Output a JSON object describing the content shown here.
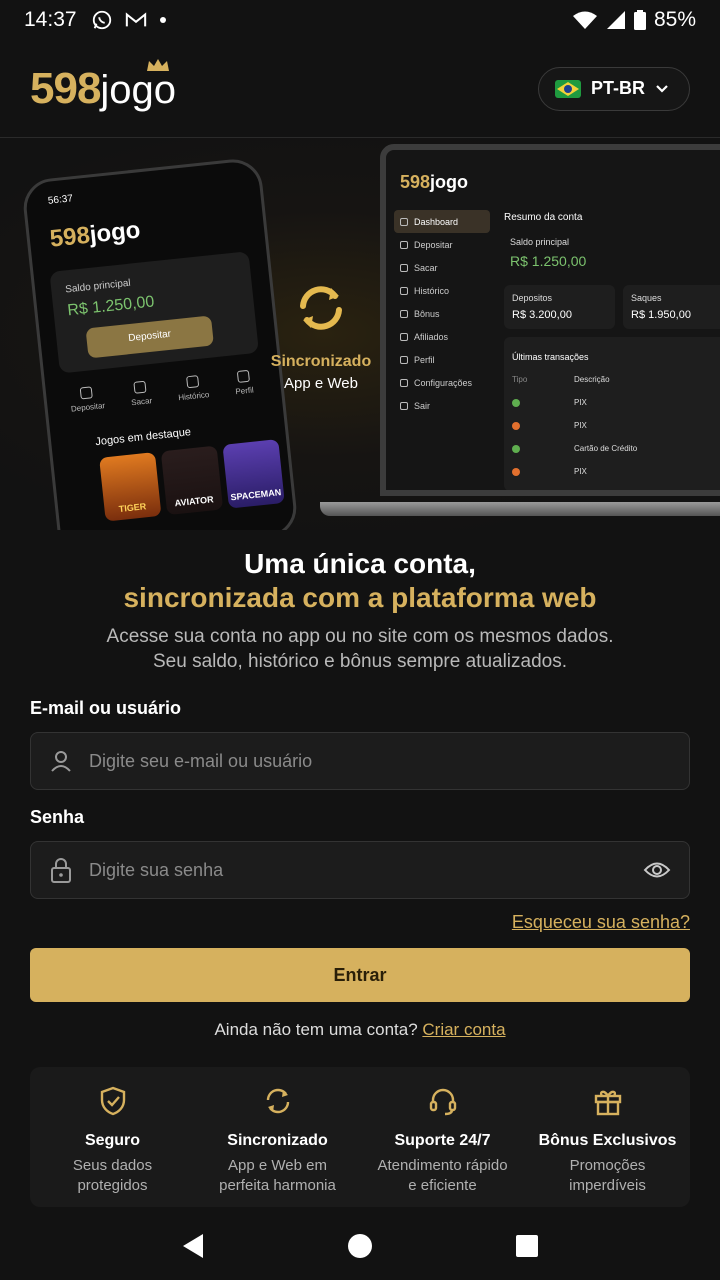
{
  "status_bar": {
    "time": "14:37",
    "battery": "85%"
  },
  "header": {
    "logo_number": "598",
    "logo_word": "jogo",
    "language": "PT-BR"
  },
  "hero": {
    "phone": {
      "time": "56:37",
      "logo_number": "598",
      "logo_word": "jogo",
      "balance_label": "Saldo principal",
      "balance_value": "R$ 1.250,00",
      "deposit_button": "Depositar",
      "nav": [
        "Depositar",
        "Sacar",
        "Histórico",
        "Perfil"
      ],
      "featured_label": "Jogos em destaque",
      "games": [
        "TIGER",
        "AVIATOR",
        "SPACEMAN"
      ]
    },
    "sync": {
      "title": "Sincronizado",
      "subtitle": "App e Web"
    },
    "laptop": {
      "logo_number": "598",
      "logo_word": "jogo",
      "menu": [
        "Dashboard",
        "Depositar",
        "Sacar",
        "Histórico",
        "Bônus",
        "Afiliados",
        "Perfil",
        "Configurações",
        "Sair"
      ],
      "summary_title": "Resumo da conta",
      "balance_label": "Saldo principal",
      "balance_value": "R$ 1.250,00",
      "deposits_label": "Depositos",
      "deposits_value": "R$ 3.200,00",
      "withdrawals_label": "Saques",
      "withdrawals_value": "R$ 1.950,00",
      "transactions_title": "Últimas transações",
      "col_type": "Tipo",
      "col_desc": "Descrição",
      "rows": [
        {
          "desc": "PIX",
          "color": "#5fae4f"
        },
        {
          "desc": "PIX",
          "color": "#e2702e"
        },
        {
          "desc": "Cartão de Crédito",
          "color": "#5fae4f"
        },
        {
          "desc": "PIX",
          "color": "#e2702e"
        }
      ]
    }
  },
  "headline": {
    "line1": "Uma única conta,",
    "line2": "sincronizada com a plataforma web",
    "sub1": "Acesse sua conta no app ou no site com os mesmos dados.",
    "sub2": "Seu saldo, histórico e bônus sempre atualizados."
  },
  "form": {
    "email_label": "E-mail ou usuário",
    "email_placeholder": "Digite seu e-mail ou usuário",
    "password_label": "Senha",
    "password_placeholder": "Digite sua senha",
    "forgot": "Esqueceu sua senha?",
    "submit": "Entrar",
    "signup_text": "Ainda não tem uma conta?",
    "signup_link": "Criar conta"
  },
  "features": [
    {
      "icon": "shield-check-icon",
      "title": "Seguro",
      "line1": "Seus dados",
      "line2": "protegidos"
    },
    {
      "icon": "sync-icon",
      "title": "Sincronizado",
      "line1": "App e Web em",
      "line2": "perfeita harmonia"
    },
    {
      "icon": "headset-icon",
      "title": "Suporte 24/7",
      "line1": "Atendimento rápido",
      "line2": "e eficiente"
    },
    {
      "icon": "gift-icon",
      "title": "Bônus Exclusivos",
      "line1": "Promoções",
      "line2": "imperdíveis"
    }
  ],
  "colors": {
    "accent": "#d6b15e",
    "background": "#121212",
    "positive": "#7cc36e"
  }
}
